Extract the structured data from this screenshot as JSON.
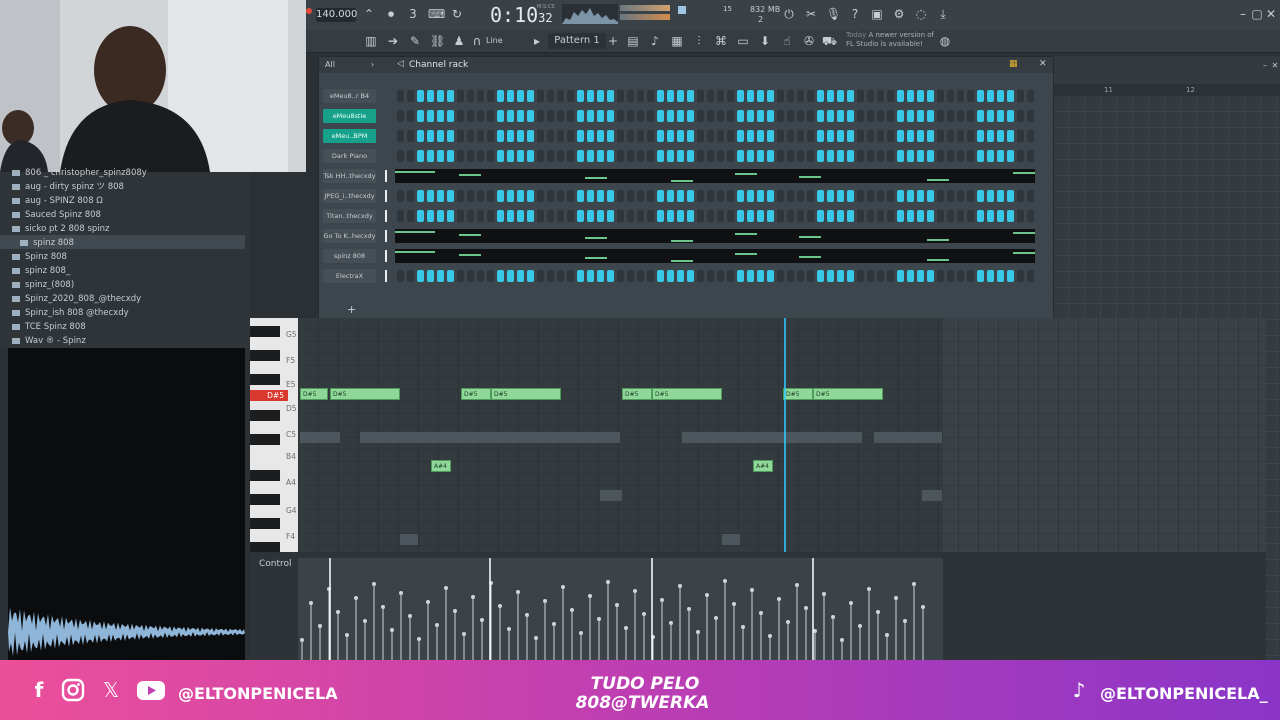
{
  "toolbar": {
    "tempo": "140.000",
    "time": "0:10",
    "time_sub": "32",
    "time_unit": "M:S:CS",
    "cpu_mem": "832 MB",
    "cpu_val": "15",
    "voices": "2",
    "pattern": "Pattern 1",
    "snap_mode": "Line",
    "news_date": "Today",
    "news_text": "A newer version of FL Studio is available!"
  },
  "browser": {
    "items": [
      "806 _ christopher_spinz808y",
      "aug - dirty spinz ツ 808",
      "aug - SPINZ 808 Ω",
      "Sauced Spinz 808",
      "sicko pt 2 808 spinz",
      "spinz 808",
      "Spinz 808",
      "spinz 808_",
      "spinz_(808)",
      "Spinz_2020_808_@thecxdy",
      "Spinz_ish 808 @thecxdy",
      "TCE Spinz 808",
      "Wav ® - Spinz"
    ],
    "selected": "spinz 808"
  },
  "channel_rack": {
    "title": "Channel rack",
    "filter": "All",
    "channels": [
      {
        "name": "eMeu8..r B4",
        "highlight": false,
        "type": "steps"
      },
      {
        "name": "eMeu8stie",
        "highlight": true,
        "type": "steps"
      },
      {
        "name": "eMeu..BPM",
        "highlight": true,
        "type": "steps"
      },
      {
        "name": "Dark Piano",
        "highlight": false,
        "type": "steps"
      },
      {
        "name": "Tsk HH..thecxdy",
        "highlight": false,
        "type": "roll"
      },
      {
        "name": "JPEG_i..thecxdy",
        "highlight": false,
        "type": "steps"
      },
      {
        "name": "Titan..thecxdy",
        "highlight": false,
        "type": "steps"
      },
      {
        "name": "Go To K..hecxdy",
        "highlight": false,
        "type": "roll"
      },
      {
        "name": "spinz 808",
        "highlight": false,
        "type": "roll"
      },
      {
        "name": "ElectraX",
        "highlight": false,
        "type": "steps"
      }
    ],
    "add_label": "+"
  },
  "playlist": {
    "bar_labels": [
      "11",
      "12"
    ]
  },
  "piano_roll": {
    "key_labels": [
      "G5",
      "F5",
      "E5",
      "D#5",
      "D5",
      "C5",
      "B4",
      "A4",
      "G4",
      "F4"
    ],
    "highlight_key": "D#5",
    "notes": [
      {
        "label": "D#5",
        "row": "D#5"
      },
      {
        "label": "D#5",
        "row": "D#5"
      },
      {
        "label": "D#5",
        "row": "D#5"
      },
      {
        "label": "D#5",
        "row": "D#5"
      },
      {
        "label": "D#5",
        "row": "D#5"
      },
      {
        "label": "D#5",
        "row": "D#5"
      },
      {
        "label": "D#5",
        "row": "D#5"
      },
      {
        "label": "D#5",
        "row": "D#5"
      },
      {
        "label": "A#4",
        "row": "A#4"
      },
      {
        "label": "A#4",
        "row": "A#4"
      }
    ],
    "control_label": "Control"
  },
  "footer": {
    "left_handle": "@ELTONPENICELA",
    "center_line1": "TUDO PELO",
    "center_line2": "808@TWERKA",
    "right_handle": "@ELTONPENICELA_",
    "bg_start": "#ec4f9a",
    "bg_end": "#8a35c8"
  },
  "colors": {
    "step_on": "#38c8e8",
    "step_off": "#30373c",
    "note": "#8fd89a",
    "playhead": "#2ec8ff"
  }
}
